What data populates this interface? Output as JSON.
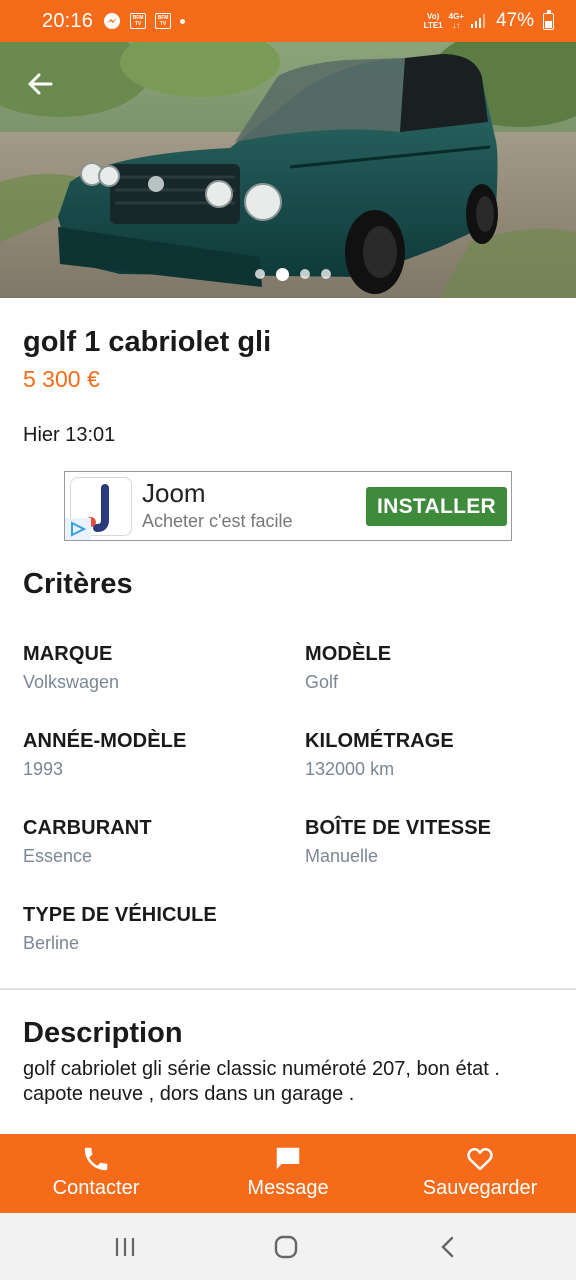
{
  "status_bar": {
    "time": "20:16",
    "network_top": "VoLTE1",
    "network_vo": "Vo)",
    "network_lte": "LTE1",
    "network_type": "4G+",
    "battery": "47%",
    "icons": [
      "messenger-icon",
      "bfm-tv-icon",
      "bfm-tv-icon",
      "notification-dot-icon",
      "signal-icon",
      "battery-icon"
    ]
  },
  "gallery": {
    "image_count": 4,
    "active_index": 1,
    "back_icon": "arrow-left-icon"
  },
  "listing": {
    "title": "golf 1 cabriolet gli",
    "price": "5 300 €",
    "date": "Hier 13:01"
  },
  "ad": {
    "brand": "Joom",
    "tagline": "Acheter c'est facile",
    "cta": "INSTALLER"
  },
  "criteria": {
    "title": "Critères",
    "items": [
      {
        "label": "MARQUE",
        "value": "Volkswagen"
      },
      {
        "label": "MODÈLE",
        "value": "Golf"
      },
      {
        "label": "ANNÉE-MODÈLE",
        "value": "1993"
      },
      {
        "label": "KILOMÉTRAGE",
        "value": "132000 km"
      },
      {
        "label": "CARBURANT",
        "value": "Essence"
      },
      {
        "label": "BOÎTE DE VITESSE",
        "value": "Manuelle"
      },
      {
        "label": "TYPE DE VÉHICULE",
        "value": "Berline"
      }
    ]
  },
  "description": {
    "title": "Description",
    "text": "golf cabriolet gli série classic numéroté 207, bon état . capote neuve , dors dans un garage ."
  },
  "actions": [
    {
      "label": "Contacter",
      "icon": "phone-icon"
    },
    {
      "label": "Message",
      "icon": "chat-bubble-icon"
    },
    {
      "label": "Sauvegarder",
      "icon": "heart-icon"
    }
  ],
  "colors": {
    "brand_orange": "#f56b1a",
    "install_green": "#3f8b3c",
    "value_grey": "#7b8794"
  }
}
